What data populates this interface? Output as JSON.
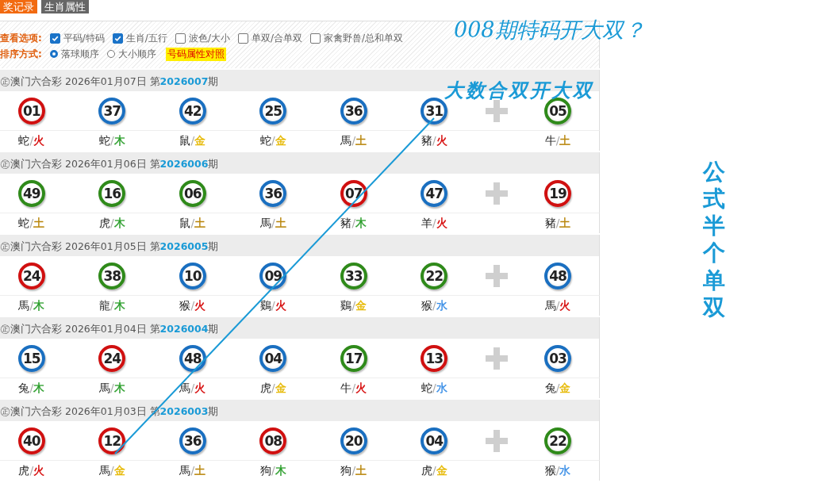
{
  "tabs": [
    {
      "label": "奖记录",
      "selected": true
    },
    {
      "label": "生肖属性",
      "selected": false
    }
  ],
  "options": {
    "label": "查看选项:",
    "items": [
      {
        "label": "平码/特码",
        "checked": true
      },
      {
        "label": "生肖/五行",
        "checked": true
      },
      {
        "label": "波色/大小",
        "checked": false
      },
      {
        "label": "单双/合单双",
        "checked": false
      },
      {
        "label": "家禽野兽/总和单双",
        "checked": false
      }
    ]
  },
  "sort": {
    "label": "排序方式:",
    "items": [
      {
        "label": "落球顺序",
        "selected": true
      },
      {
        "label": "大小顺序",
        "selected": false
      }
    ],
    "link": "号码属性对照"
  },
  "draws": [
    {
      "header": "㊣澳门六合彩 2026年01月07日 第**2026007**期",
      "balls": [
        {
          "number": "01",
          "color": "#d01010",
          "zodiac": "蛇",
          "separator": "/",
          "element": {
            "text": "火",
            "color": "#d40000"
          }
        },
        {
          "number": "37",
          "color": "#1a6fc0",
          "zodiac": "蛇",
          "separator": "/",
          "element": {
            "text": "木",
            "color": "#2a9d2a"
          }
        },
        {
          "number": "42",
          "color": "#1a6fc0",
          "zodiac": "鼠",
          "separator": "/",
          "element": {
            "text": "金",
            "color": "#e6b800"
          }
        },
        {
          "number": "25",
          "color": "#1a6fc0",
          "zodiac": "蛇",
          "separator": "/",
          "element": {
            "text": "金",
            "color": "#e6b800"
          }
        },
        {
          "number": "36",
          "color": "#1a6fc0",
          "zodiac": "馬",
          "separator": "/",
          "element": {
            "text": "土",
            "color": "#b8860b"
          }
        },
        {
          "number": "31",
          "color": "#1a6fc0",
          "zodiac": "豬",
          "separator": "/",
          "element": {
            "text": "火",
            "color": "#d40000"
          }
        }
      ],
      "special": {
        "number": "05",
        "color": "#2f8a1a",
        "zodiac": "牛",
        "separator": "/",
        "element": {
          "text": "土",
          "color": "#b8860b"
        }
      }
    },
    {
      "header": "㊣澳门六合彩 2026年01月06日 第**2026006**期",
      "balls": [
        {
          "number": "49",
          "color": "#2f8a1a",
          "zodiac": "蛇",
          "separator": "/",
          "element": {
            "text": "土",
            "color": "#b8860b"
          }
        },
        {
          "number": "16",
          "color": "#2f8a1a",
          "zodiac": "虎",
          "separator": "/",
          "element": {
            "text": "木",
            "color": "#2a9d2a"
          }
        },
        {
          "number": "06",
          "color": "#2f8a1a",
          "zodiac": "鼠",
          "separator": "/",
          "element": {
            "text": "土",
            "color": "#b8860b"
          }
        },
        {
          "number": "36",
          "color": "#1a6fc0",
          "zodiac": "馬",
          "separator": "/",
          "element": {
            "text": "土",
            "color": "#b8860b"
          }
        },
        {
          "number": "07",
          "color": "#d01010",
          "zodiac": "豬",
          "separator": "/",
          "element": {
            "text": "木",
            "color": "#2a9d2a"
          }
        },
        {
          "number": "47",
          "color": "#1a6fc0",
          "zodiac": "羊",
          "separator": "/",
          "element": {
            "text": "火",
            "color": "#d40000"
          }
        }
      ],
      "special": {
        "number": "19",
        "color": "#d01010",
        "zodiac": "豬",
        "separator": "/",
        "element": {
          "text": "土",
          "color": "#b8860b"
        }
      }
    },
    {
      "header": "㊣澳门六合彩 2026年01月05日 第**2026005**期",
      "balls": [
        {
          "number": "24",
          "color": "#d01010",
          "zodiac": "馬",
          "separator": "/",
          "element": {
            "text": "木",
            "color": "#2a9d2a"
          }
        },
        {
          "number": "38",
          "color": "#2f8a1a",
          "zodiac": "龍",
          "separator": "/",
          "element": {
            "text": "木",
            "color": "#2a9d2a"
          }
        },
        {
          "number": "10",
          "color": "#1a6fc0",
          "zodiac": "猴",
          "separator": "/",
          "element": {
            "text": "火",
            "color": "#d40000"
          }
        },
        {
          "number": "09",
          "color": "#1a6fc0",
          "zodiac": "鷄",
          "separator": "/",
          "element": {
            "text": "火",
            "color": "#d40000"
          }
        },
        {
          "number": "33",
          "color": "#2f8a1a",
          "zodiac": "鷄",
          "separator": "/",
          "element": {
            "text": "金",
            "color": "#e6b800"
          }
        },
        {
          "number": "22",
          "color": "#2f8a1a",
          "zodiac": "猴",
          "separator": "/",
          "element": {
            "text": "水",
            "color": "#3a8ee6"
          }
        }
      ],
      "special": {
        "number": "48",
        "color": "#1a6fc0",
        "zodiac": "馬",
        "separator": "/",
        "element": {
          "text": "火",
          "color": "#d40000"
        }
      }
    },
    {
      "header": "㊣澳门六合彩 2026年01月04日 第**2026004**期",
      "balls": [
        {
          "number": "15",
          "color": "#1a6fc0",
          "zodiac": "兔",
          "separator": "/",
          "element": {
            "text": "木",
            "color": "#2a9d2a"
          }
        },
        {
          "number": "24",
          "color": "#d01010",
          "zodiac": "馬",
          "separator": "/",
          "element": {
            "text": "木",
            "color": "#2a9d2a"
          }
        },
        {
          "number": "48",
          "color": "#1a6fc0",
          "zodiac": "馬",
          "separator": "/",
          "element": {
            "text": "火",
            "color": "#d40000"
          }
        },
        {
          "number": "04",
          "color": "#1a6fc0",
          "zodiac": "虎",
          "separator": "/",
          "element": {
            "text": "金",
            "color": "#e6b800"
          }
        },
        {
          "number": "17",
          "color": "#2f8a1a",
          "zodiac": "牛",
          "separator": "/",
          "element": {
            "text": "火",
            "color": "#d40000"
          }
        },
        {
          "number": "13",
          "color": "#d01010",
          "zodiac": "蛇",
          "separator": "/",
          "element": {
            "text": "水",
            "color": "#3a8ee6"
          }
        }
      ],
      "special": {
        "number": "03",
        "color": "#1a6fc0",
        "zodiac": "兔",
        "separator": "/",
        "element": {
          "text": "金",
          "color": "#e6b800"
        }
      }
    },
    {
      "header": "㊣澳门六合彩 2026年01月03日 第**2026003**期",
      "balls": [
        {
          "number": "40",
          "color": "#d01010",
          "zodiac": "虎",
          "separator": "/",
          "element": {
            "text": "火",
            "color": "#d40000"
          }
        },
        {
          "number": "12",
          "color": "#d01010",
          "zodiac": "馬",
          "separator": "/",
          "element": {
            "text": "金",
            "color": "#e6b800"
          }
        },
        {
          "number": "36",
          "color": "#1a6fc0",
          "zodiac": "馬",
          "separator": "/",
          "element": {
            "text": "土",
            "color": "#b8860b"
          }
        },
        {
          "number": "08",
          "color": "#d01010",
          "zodiac": "狗",
          "separator": "/",
          "element": {
            "text": "木",
            "color": "#2a9d2a"
          }
        },
        {
          "number": "20",
          "color": "#1a6fc0",
          "zodiac": "狗",
          "separator": "/",
          "element": {
            "text": "土",
            "color": "#b8860b"
          }
        },
        {
          "number": "04",
          "color": "#1a6fc0",
          "zodiac": "虎",
          "separator": "/",
          "element": {
            "text": "金",
            "color": "#e6b800"
          }
        }
      ],
      "special": {
        "number": "22",
        "color": "#2f8a1a",
        "zodiac": "猴",
        "separator": "/",
        "element": {
          "text": "水",
          "color": "#3a8ee6"
        }
      }
    }
  ],
  "annotations": {
    "question": "008期特码开大双？",
    "answer": "大数合双开大双",
    "vertical": "公式半个单双"
  }
}
